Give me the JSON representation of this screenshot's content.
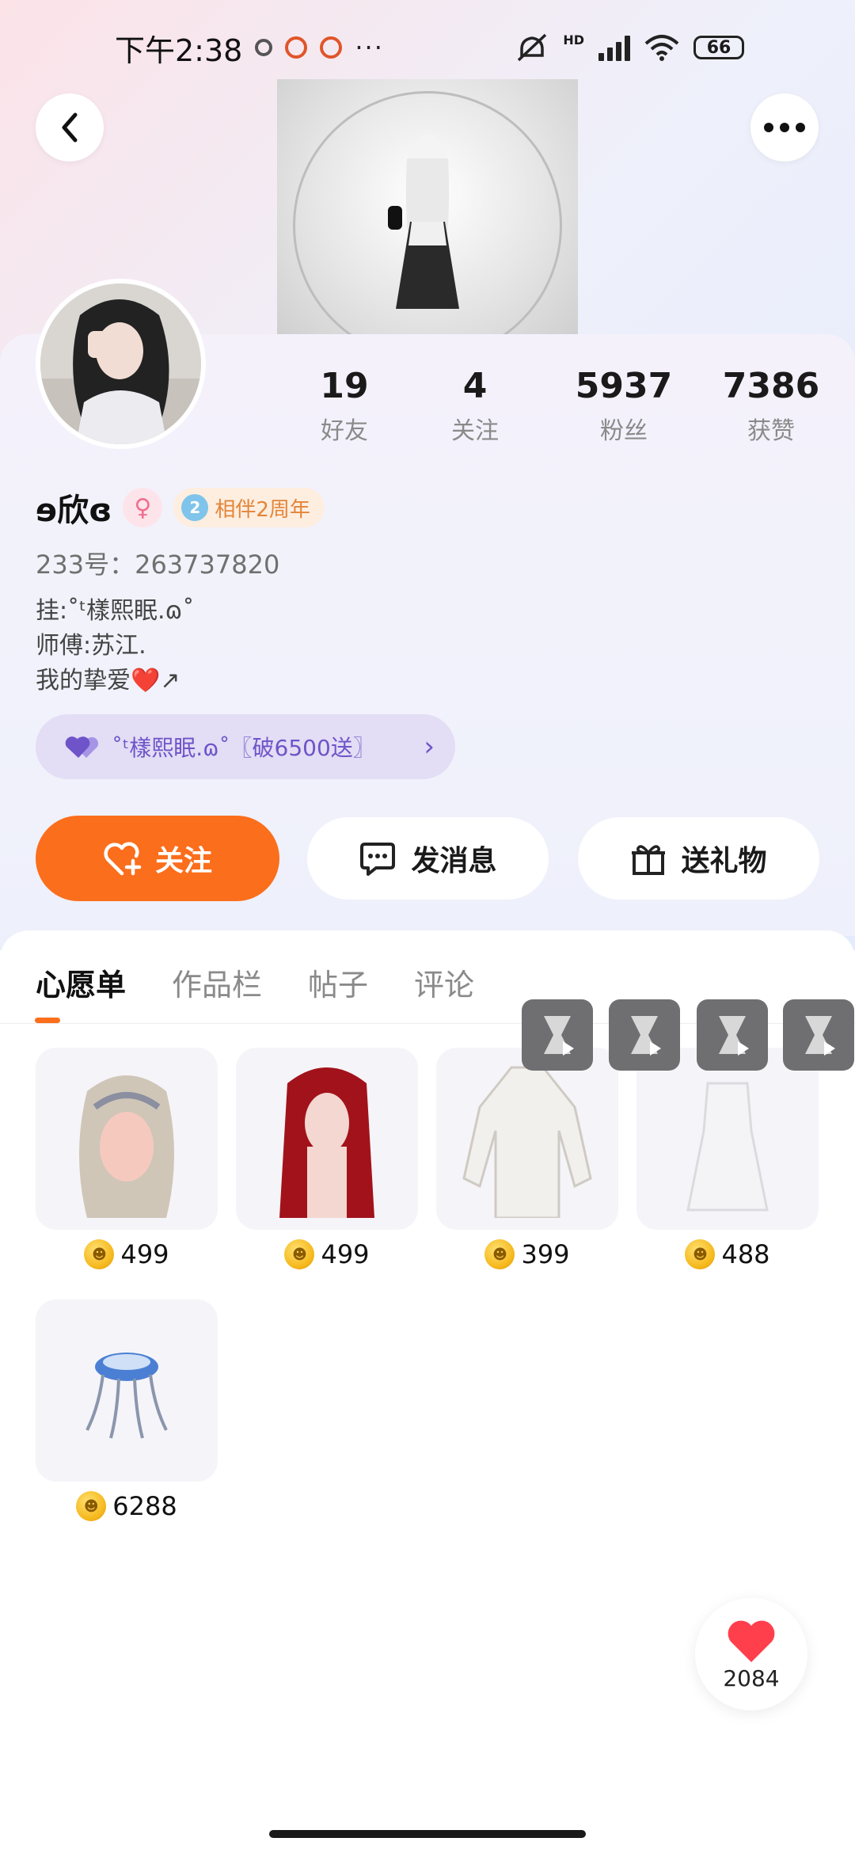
{
  "status_bar": {
    "time": "下午2:38",
    "dots": "···",
    "network_label": "HD",
    "battery": "66"
  },
  "header": {
    "back_icon": "chevron-left-icon",
    "more_icon": "more-dots-icon"
  },
  "profile": {
    "stats": [
      {
        "value": "19",
        "label": "好友"
      },
      {
        "value": "4",
        "label": "关注"
      },
      {
        "value": "5937",
        "label": "粉丝"
      },
      {
        "value": "7386",
        "label": "获赞"
      }
    ],
    "name": "ɘ欣ɞ",
    "gender_symbol": "♀",
    "anniversary": {
      "icon_text": "2",
      "label": "相伴2周年"
    },
    "uid": "233号：263737820",
    "bio": [
      "挂:˚ᵗ樣熙眠.ɷ˚",
      "师傅:苏江.",
      "我的挚爱❤️↗"
    ],
    "fan_group": "˚ᵗ樣熙眠.ɷ˚〖破6500送〗",
    "fan_chevron": "›"
  },
  "actions": {
    "follow": "关注",
    "message": "发消息",
    "gift": "送礼物"
  },
  "tabs": [
    {
      "label": "心愿单",
      "active": true
    },
    {
      "label": "作品栏",
      "active": false
    },
    {
      "label": "帖子",
      "active": false
    },
    {
      "label": "评论",
      "active": false
    }
  ],
  "wishlist": [
    {
      "name": "hair-silver-twintails",
      "price": "499"
    },
    {
      "name": "hair-red-long",
      "price": "499"
    },
    {
      "name": "white-sweater-dress",
      "price": "399"
    },
    {
      "name": "white-mini-dress",
      "price": "488"
    },
    {
      "name": "jellyfish-accessory",
      "price": "6288"
    }
  ],
  "like_float": {
    "count": "2084"
  },
  "colors": {
    "accent": "#fb6e1c",
    "fan_purple": "#6e54c8",
    "anniv_orange": "#e48538"
  }
}
